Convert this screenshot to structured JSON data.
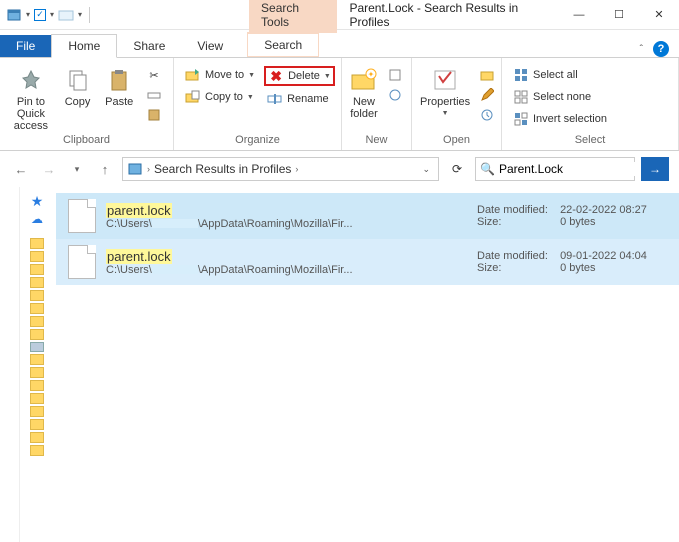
{
  "titlebar": {
    "contextual_tab": "Search Tools",
    "title": "Parent.Lock - Search Results in Profiles"
  },
  "tabs": {
    "file": "File",
    "home": "Home",
    "share": "Share",
    "view": "View",
    "search": "Search"
  },
  "ribbon": {
    "clipboard": {
      "pin": "Pin to Quick access",
      "copy": "Copy",
      "paste": "Paste",
      "label": "Clipboard"
    },
    "organize": {
      "move": "Move to",
      "copyto": "Copy to",
      "delete": "Delete",
      "rename": "Rename",
      "label": "Organize"
    },
    "new": {
      "newfolder": "New folder",
      "label": "New"
    },
    "open": {
      "properties": "Properties",
      "label": "Open"
    },
    "select": {
      "all": "Select all",
      "none": "Select none",
      "invert": "Invert selection",
      "label": "Select"
    }
  },
  "address": {
    "breadcrumb": "Search Results in Profiles",
    "search_value": "Parent.Lock"
  },
  "results": [
    {
      "name": "parent.lock",
      "path_prefix": "C:\\Users\\",
      "path_suffix": "\\AppData\\Roaming\\Mozilla\\Fir...",
      "modified_label": "Date modified:",
      "modified": "22-02-2022 08:27",
      "size_label": "Size:",
      "size": "0 bytes"
    },
    {
      "name": "parent.lock",
      "path_prefix": "C:\\Users\\",
      "path_suffix": "\\AppData\\Roaming\\Mozilla\\Fir...",
      "modified_label": "Date modified:",
      "modified": "09-01-2022 04:04",
      "size_label": "Size:",
      "size": "0 bytes"
    }
  ]
}
